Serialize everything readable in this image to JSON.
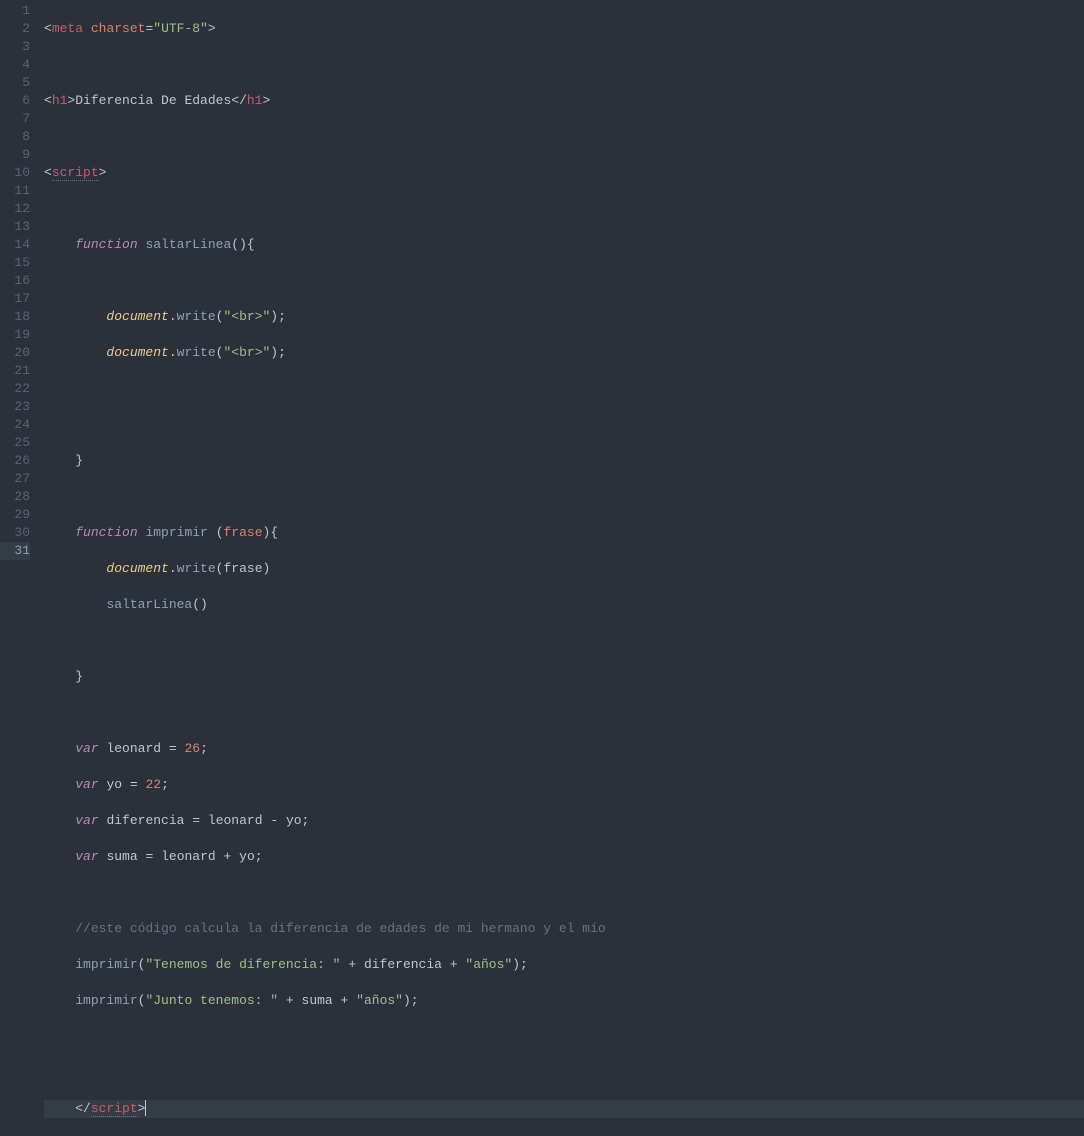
{
  "lineNumbers": [
    "1",
    "2",
    "3",
    "4",
    "5",
    "6",
    "7",
    "8",
    "9",
    "10",
    "11",
    "12",
    "13",
    "14",
    "15",
    "16",
    "17",
    "18",
    "19",
    "20",
    "21",
    "22",
    "23",
    "24",
    "25",
    "26",
    "27",
    "28",
    "29",
    "30",
    "31"
  ],
  "currentLine": 31,
  "code": {
    "l1": {
      "tag": "meta",
      "attr": "charset",
      "val": "\"UTF-8\""
    },
    "l3": {
      "openTag": "h1",
      "text": "Diferencia De Edades",
      "closeTag": "h1"
    },
    "l5": {
      "tag": "script"
    },
    "l7": {
      "kw": "function",
      "name": "saltarLinea"
    },
    "l9": {
      "obj": "document",
      "method": "write",
      "arg": "\"<br>\""
    },
    "l10": {
      "obj": "document",
      "method": "write",
      "arg": "\"<br>\""
    },
    "l15": {
      "kw": "function",
      "name": "imprimir",
      "param": "frase"
    },
    "l16": {
      "obj": "document",
      "method": "write",
      "arg": "frase"
    },
    "l17": {
      "call": "saltarLinea"
    },
    "l21": {
      "kw": "var",
      "name": "leonard",
      "val": "26"
    },
    "l22": {
      "kw": "var",
      "name": "yo",
      "val": "22"
    },
    "l23": {
      "kw": "var",
      "name": "diferencia",
      "lhs": "leonard",
      "op": "-",
      "rhs": "yo"
    },
    "l24": {
      "kw": "var",
      "name": "suma",
      "lhs": "leonard",
      "op": "+",
      "rhs": "yo"
    },
    "l26": {
      "comment": "//este código calcula la diferencia de edades de mi hermano y el mío"
    },
    "l27": {
      "call": "imprimir",
      "s1": "\"Tenemos de diferencia: \"",
      "v": "diferencia",
      "s2": "\"años\""
    },
    "l28": {
      "call": "imprimir",
      "s1": "\"Junto tenemos: \"",
      "v": "suma",
      "s2": "\"años\""
    },
    "l31": {
      "closeTag": "script"
    }
  }
}
